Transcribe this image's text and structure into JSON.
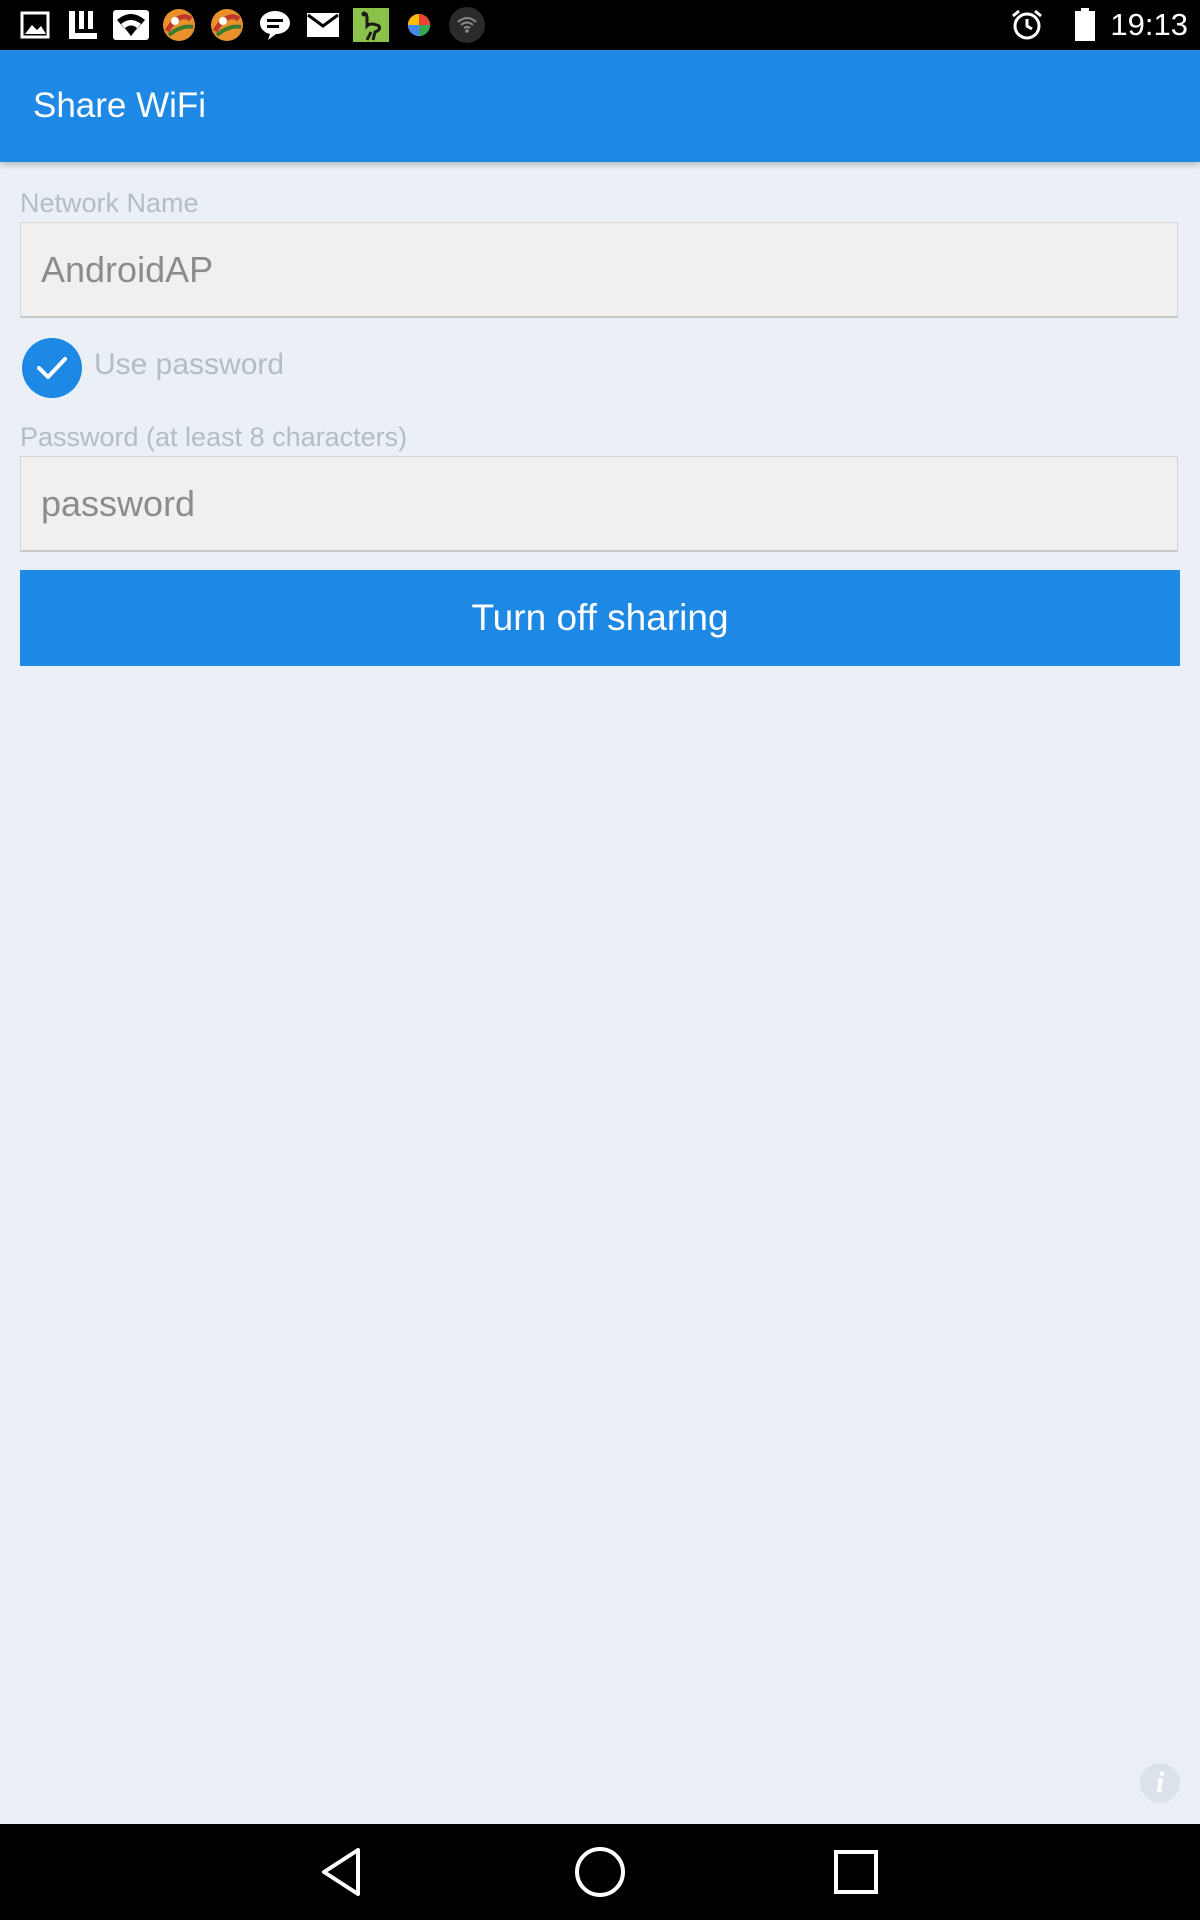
{
  "status_bar": {
    "time": "19:13",
    "icons_left": [
      "gallery-icon",
      "app-icon",
      "wifi-icon",
      "game-icon",
      "game-icon",
      "chat-icon",
      "mail-icon",
      "ostrich-app-icon",
      "photos-icon",
      "wifi-dark-icon"
    ],
    "icons_right": [
      "alarm-icon",
      "battery-icon"
    ]
  },
  "app_bar": {
    "title": "Share WiFi",
    "color": "#1e88e5"
  },
  "form": {
    "network_name_label": "Network Name",
    "network_name_value": "AndroidAP",
    "use_password_label": "Use password",
    "use_password_checked": true,
    "password_label": "Password (at least 8 characters)",
    "password_value": "password",
    "button_label": "Turn off sharing"
  },
  "info": {
    "glyph": "i"
  },
  "nav_bar": {
    "items": [
      "back-icon",
      "home-icon",
      "recents-icon"
    ]
  }
}
